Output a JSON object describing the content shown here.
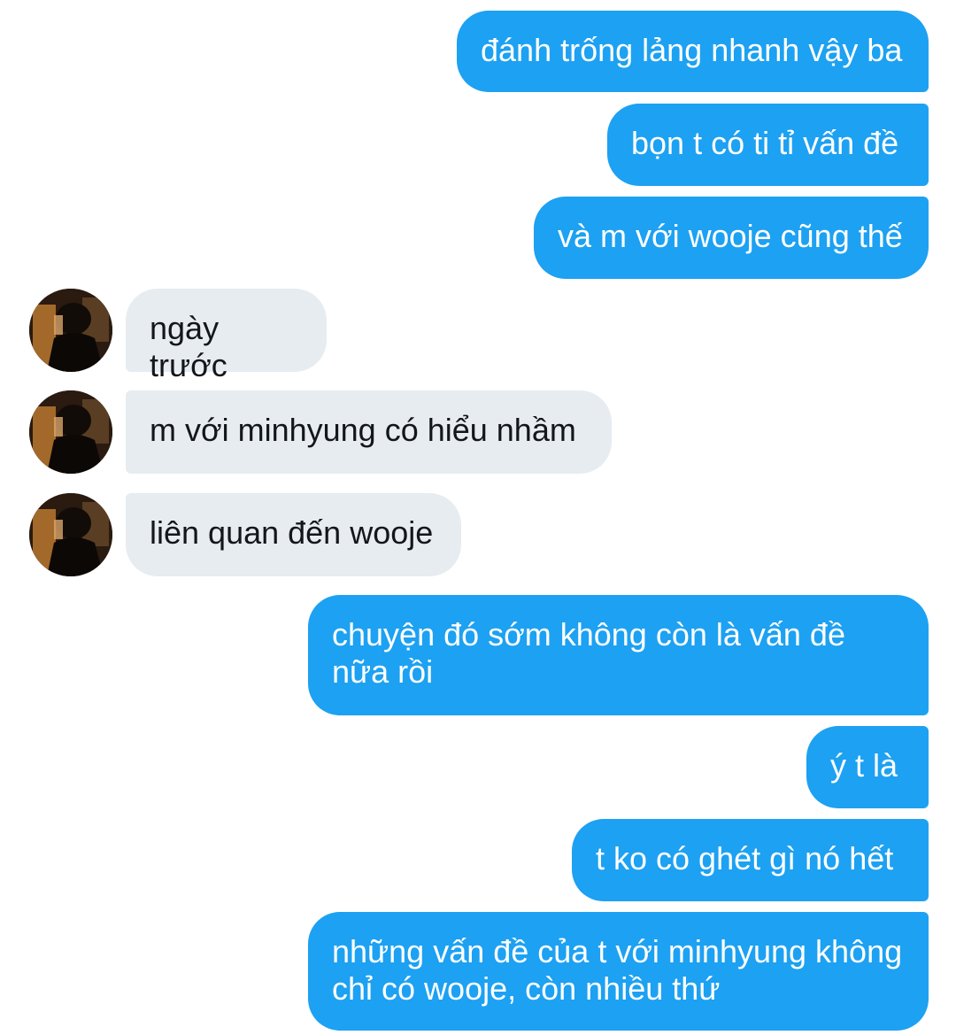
{
  "colors": {
    "sent_bubble": "#1da1f2",
    "received_bubble": "#e6ecf0",
    "sent_text": "#ffffff",
    "received_text": "#14171a"
  },
  "messages": [
    {
      "direction": "sent",
      "text": "đánh trống lảng nhanh vậy ba"
    },
    {
      "direction": "sent",
      "text": "bọn t có ti tỉ vấn đề"
    },
    {
      "direction": "sent",
      "text": "và m với wooje cũng thế"
    },
    {
      "direction": "received",
      "text": "ngày trước"
    },
    {
      "direction": "received",
      "text": "m với minhyung có hiểu nhầm"
    },
    {
      "direction": "received",
      "text": "liên quan đến wooje"
    },
    {
      "direction": "sent",
      "text": "chuyện đó sớm không còn là vấn đề nữa rồi"
    },
    {
      "direction": "sent",
      "text": "ý t là"
    },
    {
      "direction": "sent",
      "text": "t ko có ghét gì nó hết"
    },
    {
      "direction": "sent",
      "text": "những vấn đề của t với minhyung không chỉ có wooje, còn nhiều thứ"
    }
  ]
}
